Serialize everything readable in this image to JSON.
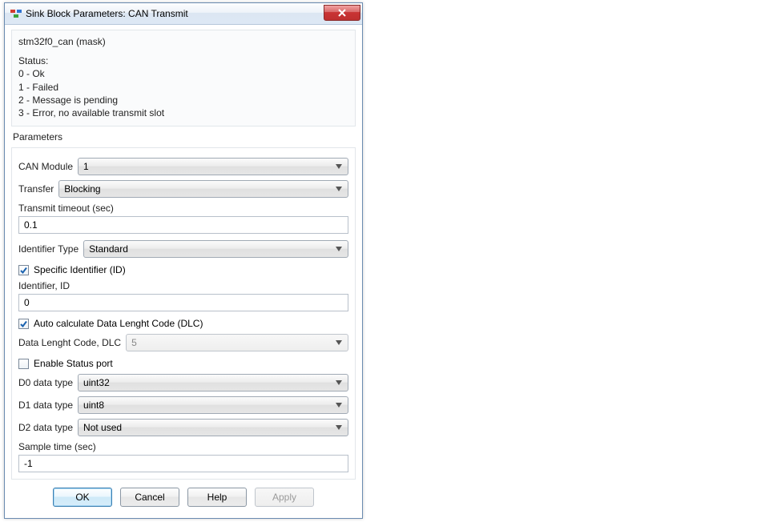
{
  "window": {
    "title": "Sink Block Parameters: CAN Transmit"
  },
  "description": {
    "mask_line": "stm32f0_can (mask)",
    "status_header": "Status:",
    "status_lines": {
      "l0": "0 - Ok",
      "l1": "1 - Failed",
      "l2": "2 - Message is pending",
      "l3": "3 - Error, no available transmit slot"
    }
  },
  "section": {
    "parameters": "Parameters"
  },
  "params": {
    "can_module": {
      "label": "CAN Module",
      "value": "1"
    },
    "transfer": {
      "label": "Transfer",
      "value": "Blocking"
    },
    "timeout": {
      "label": "Transmit timeout (sec)",
      "value": "0.1"
    },
    "id_type": {
      "label": "Identifier Type",
      "value": "Standard"
    },
    "specific_id": {
      "label": "Specific Identifier (ID)",
      "checked": true
    },
    "identifier": {
      "label": "Identifier, ID",
      "value": "0"
    },
    "auto_dlc": {
      "label": "Auto calculate Data Lenght Code (DLC)",
      "checked": true
    },
    "dlc": {
      "label": "Data Lenght Code, DLC",
      "value": "5"
    },
    "status_port": {
      "label": "Enable Status port",
      "checked": false
    },
    "d0": {
      "label": "D0 data type",
      "value": "uint32"
    },
    "d1": {
      "label": "D1 data type",
      "value": "uint8"
    },
    "d2": {
      "label": "D2 data type",
      "value": "Not used"
    },
    "sample_time": {
      "label": "Sample time (sec)",
      "value": "-1"
    }
  },
  "buttons": {
    "ok": "OK",
    "cancel": "Cancel",
    "help": "Help",
    "apply": "Apply"
  }
}
